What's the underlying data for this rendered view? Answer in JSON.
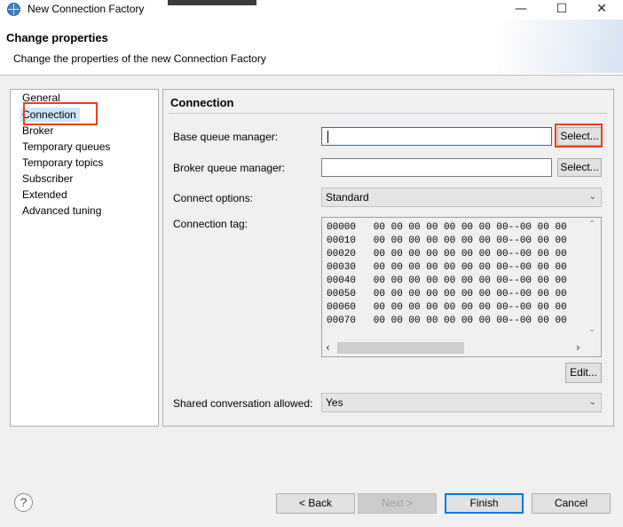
{
  "window": {
    "title": "New Connection Factory",
    "minimize_icon": "minimize-icon",
    "maximize_icon": "maximize-icon",
    "close_icon": "close-icon",
    "minimize_glyph": "—",
    "maximize_glyph": "☐",
    "close_glyph": "✕"
  },
  "header": {
    "title": "Change properties",
    "subtitle": "Change the properties of the new Connection Factory"
  },
  "nav": {
    "items": [
      {
        "label": "General"
      },
      {
        "label": "Connection",
        "selected": true
      },
      {
        "label": "Broker"
      },
      {
        "label": "Temporary queues"
      },
      {
        "label": "Temporary topics"
      },
      {
        "label": "Subscriber"
      },
      {
        "label": "Extended"
      },
      {
        "label": "Advanced tuning"
      }
    ]
  },
  "connection": {
    "section_title": "Connection",
    "base_qm_label": "Base queue manager:",
    "base_qm_value": "",
    "base_qm_select": "Select...",
    "broker_qm_label": "Broker queue manager:",
    "broker_qm_value": "",
    "broker_qm_select": "Select...",
    "connect_options_label": "Connect options:",
    "connect_options_value": "Standard",
    "connection_tag_label": "Connection tag:",
    "connection_tag_lines": [
      "00000   00 00 00 00 00 00 00 00--00 00 00",
      "00010   00 00 00 00 00 00 00 00--00 00 00",
      "00020   00 00 00 00 00 00 00 00--00 00 00",
      "00030   00 00 00 00 00 00 00 00--00 00 00",
      "00040   00 00 00 00 00 00 00 00--00 00 00",
      "00050   00 00 00 00 00 00 00 00--00 00 00",
      "00060   00 00 00 00 00 00 00 00--00 00 00",
      "00070   00 00 00 00 00 00 00 00--00 00 00"
    ],
    "edit_button": "Edit...",
    "shared_conv_label": "Shared conversation allowed:",
    "shared_conv_value": "Yes"
  },
  "footer": {
    "help": "?",
    "back": "< Back",
    "next": "Next >",
    "finish": "Finish",
    "cancel": "Cancel"
  },
  "colors": {
    "highlight": "#e8401c",
    "focus": "#0078d7",
    "selection": "#cce8ff"
  }
}
